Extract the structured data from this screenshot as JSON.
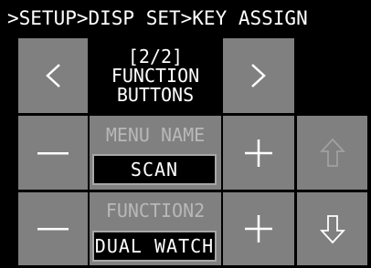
{
  "breadcrumb": ">SETUP>DISP SET>KEY ASSIGN",
  "pager": {
    "page": "[2/2]",
    "title_line1": "FUNCTION",
    "title_line2": "BUTTONS",
    "prev_icon": "chevron-left-icon",
    "next_icon": "chevron-right-icon"
  },
  "rows": [
    {
      "label": "MENU NAME",
      "value": "SCAN",
      "decrement_icon": "minus-icon",
      "increment_icon": "plus-icon"
    },
    {
      "label": "FUNCTION2",
      "value": "DUAL WATCH",
      "decrement_icon": "minus-icon",
      "increment_icon": "plus-icon"
    }
  ],
  "nav": {
    "up_icon": "arrow-up-icon",
    "up_enabled": false,
    "down_icon": "arrow-down-icon",
    "down_enabled": true
  },
  "colors": {
    "background": "#000000",
    "button": "#808080",
    "dim_text": "#b8b8b8",
    "text": "#ffffff"
  }
}
